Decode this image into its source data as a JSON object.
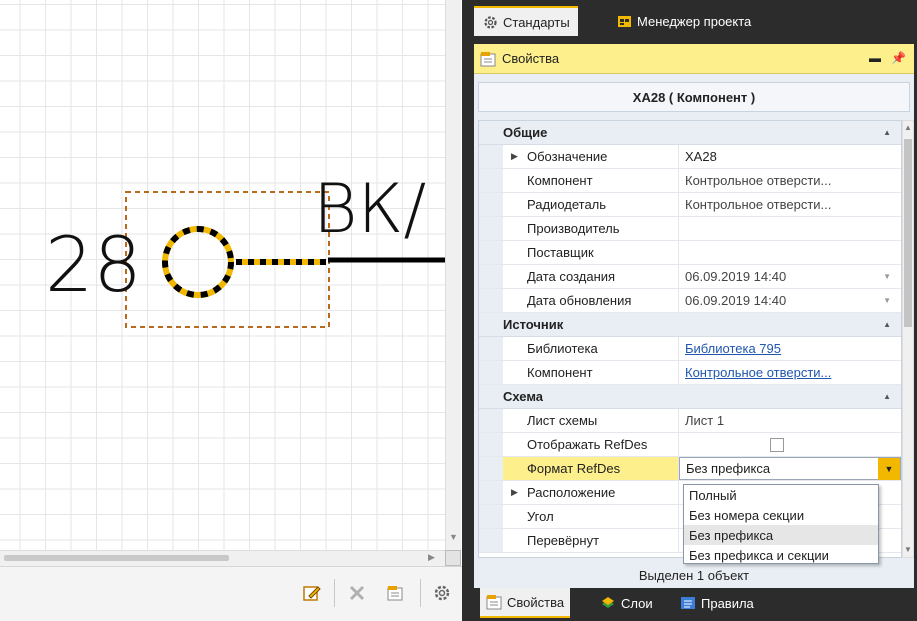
{
  "canvas": {
    "refdes_number": "28",
    "wire_label": "ВК/"
  },
  "left_toolbar": {
    "icons": [
      "edit-icon",
      "delete-icon",
      "properties-icon",
      "settings-icon"
    ]
  },
  "top_tabs": [
    {
      "label": "Стандарты",
      "icon": "gear-icon"
    },
    {
      "label": "Менеджер проекта",
      "icon": "project-icon"
    }
  ],
  "properties_panel": {
    "title": "Свойства",
    "component_title": "XA28 ( Компонент )",
    "categories": {
      "general": "Общие",
      "source": "Источник",
      "schema": "Схема"
    },
    "rows": {
      "designation": {
        "label": "Обозначение",
        "value": "XA28"
      },
      "component": {
        "label": "Компонент",
        "value": "Контрольное отверсти..."
      },
      "radiopart": {
        "label": "Радиодеталь",
        "value": "Контрольное отверсти..."
      },
      "manufacturer": {
        "label": "Производитель",
        "value": ""
      },
      "supplier": {
        "label": "Поставщик",
        "value": ""
      },
      "created": {
        "label": "Дата создания",
        "value": "06.09.2019 14:40"
      },
      "updated": {
        "label": "Дата обновления",
        "value": "06.09.2019 14:40"
      },
      "library": {
        "label": "Библиотека",
        "value": "Библиотека 795"
      },
      "src_component": {
        "label": "Компонент",
        "value": "Контрольное отверсти..."
      },
      "sheet": {
        "label": "Лист схемы",
        "value": "Лист 1"
      },
      "show_refdes": {
        "label": "Отображать RefDes",
        "checked": false
      },
      "refdes_format": {
        "label": "Формат RefDes",
        "value": "Без префикса"
      },
      "placement": {
        "label": "Расположение",
        "value": ""
      },
      "angle": {
        "label": "Угол",
        "value": ""
      },
      "flipped": {
        "label": "Перевёрнут",
        "value": ""
      }
    },
    "dropdown_options": [
      "Полный",
      "Без номера секции",
      "Без префикса",
      "Без префикса и секции"
    ],
    "dropdown_highlighted": "Без префикса",
    "status": "Выделен 1 объект"
  },
  "bottom_tabs": [
    {
      "label": "Свойства",
      "icon": "properties-icon"
    },
    {
      "label": "Слои",
      "icon": "layers-icon"
    },
    {
      "label": "Правила",
      "icon": "rules-icon"
    }
  ],
  "colors": {
    "accent_yellow": "#f2b800",
    "header_yellow": "#fdf08c",
    "link_blue": "#1f57b0",
    "selection_orange": "#b86a1e",
    "dark_chrome": "#2c2c2c"
  }
}
